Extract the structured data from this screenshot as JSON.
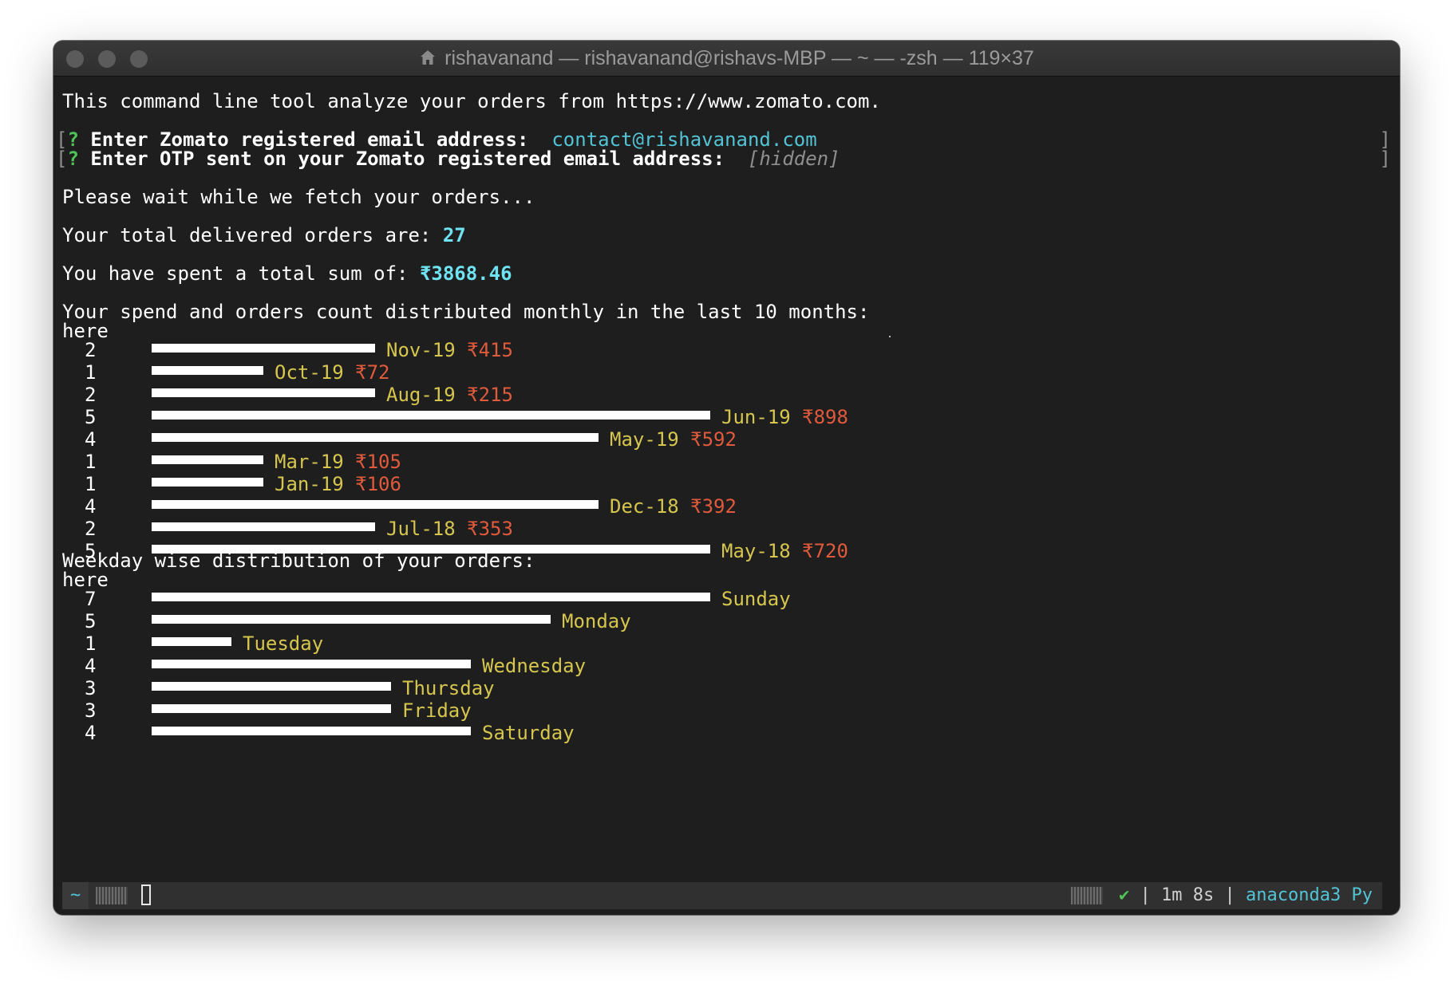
{
  "window": {
    "title": "rishavanand — rishavanand@rishavs-MBP — ~ — -zsh — 119×37"
  },
  "terminal": {
    "intro": "This command line tool analyze your orders from https://www.zomato.com.",
    "prompt_mark": "?",
    "bracket_open": "[",
    "bracket_close": "]",
    "email_prompt": "Enter Zomato registered email address:",
    "email_value": "contact@rishavanand.com",
    "otp_prompt": "Enter OTP sent on your Zomato registered email address:",
    "otp_value": "[hidden]",
    "wait_msg": "Please wait while we fetch your orders...",
    "orders_label": "Your total delivered orders are:",
    "orders_value": "27",
    "spent_label": "You have spent a total sum of:",
    "spent_value": "₹3868.46",
    "monthly_heading": "Your spend and orders count distributed monthly in the last 10 months:",
    "monthly_here": "here",
    "weekday_heading": "Weekday wise distribution of your orders:",
    "weekday_here": "here"
  },
  "monthly_rows": [
    {
      "count": "2",
      "label": "Nov-19",
      "amount": "₹415"
    },
    {
      "count": "1",
      "label": "Oct-19",
      "amount": "₹72"
    },
    {
      "count": "2",
      "label": "Aug-19",
      "amount": "₹215"
    },
    {
      "count": "5",
      "label": "Jun-19",
      "amount": "₹898"
    },
    {
      "count": "4",
      "label": "May-19",
      "amount": "₹592"
    },
    {
      "count": "1",
      "label": "Mar-19",
      "amount": "₹105"
    },
    {
      "count": "1",
      "label": "Jan-19",
      "amount": "₹106"
    },
    {
      "count": "4",
      "label": "Dec-18",
      "amount": "₹392"
    },
    {
      "count": "2",
      "label": "Jul-18",
      "amount": "₹353"
    },
    {
      "count": "5",
      "label": "May-18",
      "amount": "₹720"
    }
  ],
  "weekday_rows": [
    {
      "count": "7",
      "label": "Sunday"
    },
    {
      "count": "5",
      "label": "Monday"
    },
    {
      "count": "1",
      "label": "Tuesday"
    },
    {
      "count": "4",
      "label": "Wednesday"
    },
    {
      "count": "3",
      "label": "Thursday"
    },
    {
      "count": "3",
      "label": "Friday"
    },
    {
      "count": "4",
      "label": "Saturday"
    }
  ],
  "statusbar": {
    "tilde": "~",
    "check": "✔",
    "sep": "|",
    "duration": "1m 8s",
    "env": "anaconda3 Py"
  }
}
